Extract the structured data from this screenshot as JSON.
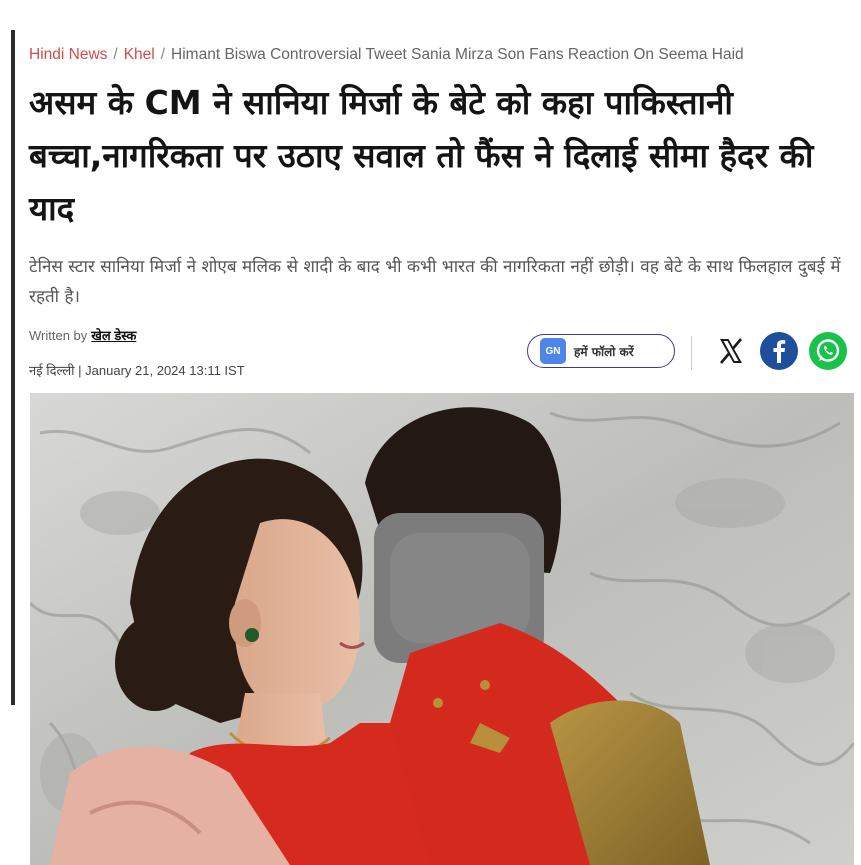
{
  "breadcrumb": {
    "items": [
      "Hindi News",
      "Khel"
    ],
    "separator": "/",
    "current": "Himant Biswa Controversial Tweet Sania Mirza Son Fans Reaction On Seema Haid"
  },
  "article": {
    "headline": "असम के CM ने सानिया मिर्जा के बेटे को कहा पाकिस्तानी बच्चा,नागरिकता पर उठाए सवाल तो फैंस ने दिलाई सीमा हैदर की याद",
    "summary": "टेनिस स्टार सानिया मिर्जा ने शोएब मलिक से शादी के बाद भी कभी भारत की नागरिकता नहीं छोड़ी। वह बेटे के साथ फिलहाल दुबई में रहती है।",
    "byline_prefix": "Written by",
    "author": "खेल डेस्क",
    "location": "नई दिल्ली",
    "date_separator": "|",
    "date": "January 21, 2024 13:11 IST"
  },
  "follow": {
    "icon_text": "GN",
    "label": "हमें फॉलो करें"
  },
  "share": {
    "icons": [
      "x-icon",
      "facebook-icon",
      "whatsapp-icon"
    ]
  },
  "colors": {
    "breadcrumb_link": "#d64a4a",
    "headline": "#141414",
    "facebook": "#1e4f9c",
    "whatsapp": "#19c24b",
    "follow_border": "#3a3a8c"
  }
}
